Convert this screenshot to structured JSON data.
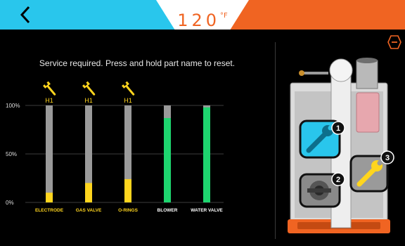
{
  "header": {
    "back_icon": "chevron-left-icon",
    "temperature": "120",
    "temperature_unit": "°F",
    "colors": {
      "left": "#29c6ec",
      "right": "#f06422",
      "center": "#ffffff",
      "accent": "#f06422"
    }
  },
  "menu_icon": "minus-hexagon-icon",
  "message": "Service required. Press and hold part name to reset.",
  "chart_data": {
    "type": "bar",
    "categories": [
      "ELECTRODE",
      "GAS VALVE",
      "O-RINGS",
      "BLOWER",
      "WATER VALVE"
    ],
    "values": [
      10,
      20,
      24,
      87,
      98
    ],
    "ylim": [
      0,
      100
    ],
    "ytick_labels": [
      "0%",
      "50%",
      "100%"
    ],
    "ytick_values": [
      0,
      50,
      100
    ],
    "alerts": [
      "H1",
      "H1",
      "H1",
      "",
      ""
    ],
    "colors": {
      "service": "#ffd51e",
      "ok": "#1ed56f",
      "track": "#9a9a9a",
      "label_service": "#ffd51e",
      "label_ok": "#ffffff"
    },
    "grid": true,
    "legend": "none"
  },
  "diagram": {
    "badges": [
      {
        "number": "1",
        "icon": "wrench-icon",
        "color": "#29c6ec"
      },
      {
        "number": "2",
        "icon": "blower-fan-icon",
        "color": "#7a7a7a"
      },
      {
        "number": "3",
        "icon": "wrench-icon",
        "color": "#ffd51e"
      }
    ]
  }
}
